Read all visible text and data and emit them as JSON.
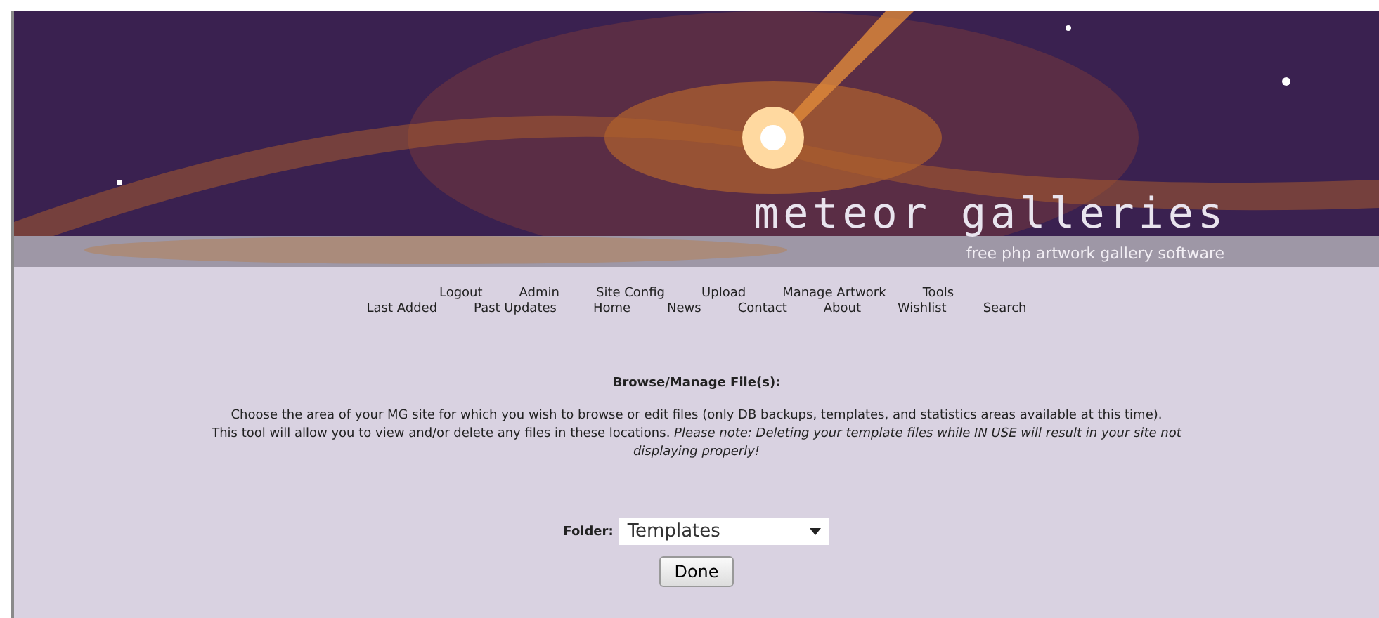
{
  "banner": {
    "title": "meteor galleries",
    "tagline": "free php artwork gallery software"
  },
  "nav": [
    [
      "Logout",
      "Admin",
      "Site Config",
      "Upload",
      "Manage Artwork",
      "Tools"
    ],
    [
      "Last Added",
      "Past Updates",
      "Home",
      "News",
      "Contact",
      "About",
      "Wishlist",
      "Search"
    ]
  ],
  "heading": "Browse/Manage File(s):",
  "intro": [
    "Choose the area of your MG site for which you wish to browse or edit files (only DB backups, templates, and statistics areas available at this time).",
    "This tool will allow you to view and/or delete any files in these locations. *Please note: Deleting your template files while IN USE will result in your site not displaying properly!*"
  ],
  "folder": {
    "label": "Folder:",
    "value": "Templates"
  },
  "buttons": [
    "Done"
  ]
}
